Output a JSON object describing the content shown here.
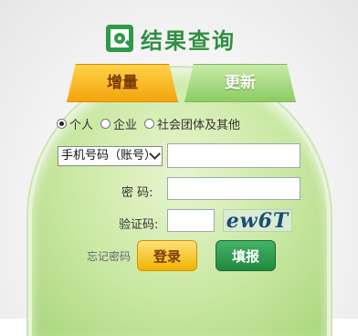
{
  "header": {
    "title": "结果查询"
  },
  "tabs": [
    {
      "label": "增量",
      "active": true
    },
    {
      "label": "更新",
      "active": false
    }
  ],
  "radio_options": [
    {
      "label": "个人",
      "selected": true
    },
    {
      "label": "企业",
      "selected": false
    },
    {
      "label": "社会团体及其他",
      "selected": false
    }
  ],
  "form": {
    "account_type_selected": "手机号码（账号）",
    "account_value": "",
    "password_label": "密 码:",
    "password_value": "",
    "captcha_label": "验证码:",
    "captcha_value": "",
    "captcha_image_text": "ew6T"
  },
  "actions": {
    "forgot_password": "忘记密码",
    "login": "登录",
    "fill": "填报"
  },
  "colors": {
    "brand_green": "#2f8f42",
    "accent_orange": "#f3a40b",
    "panel_green": "#c8e7a0"
  }
}
